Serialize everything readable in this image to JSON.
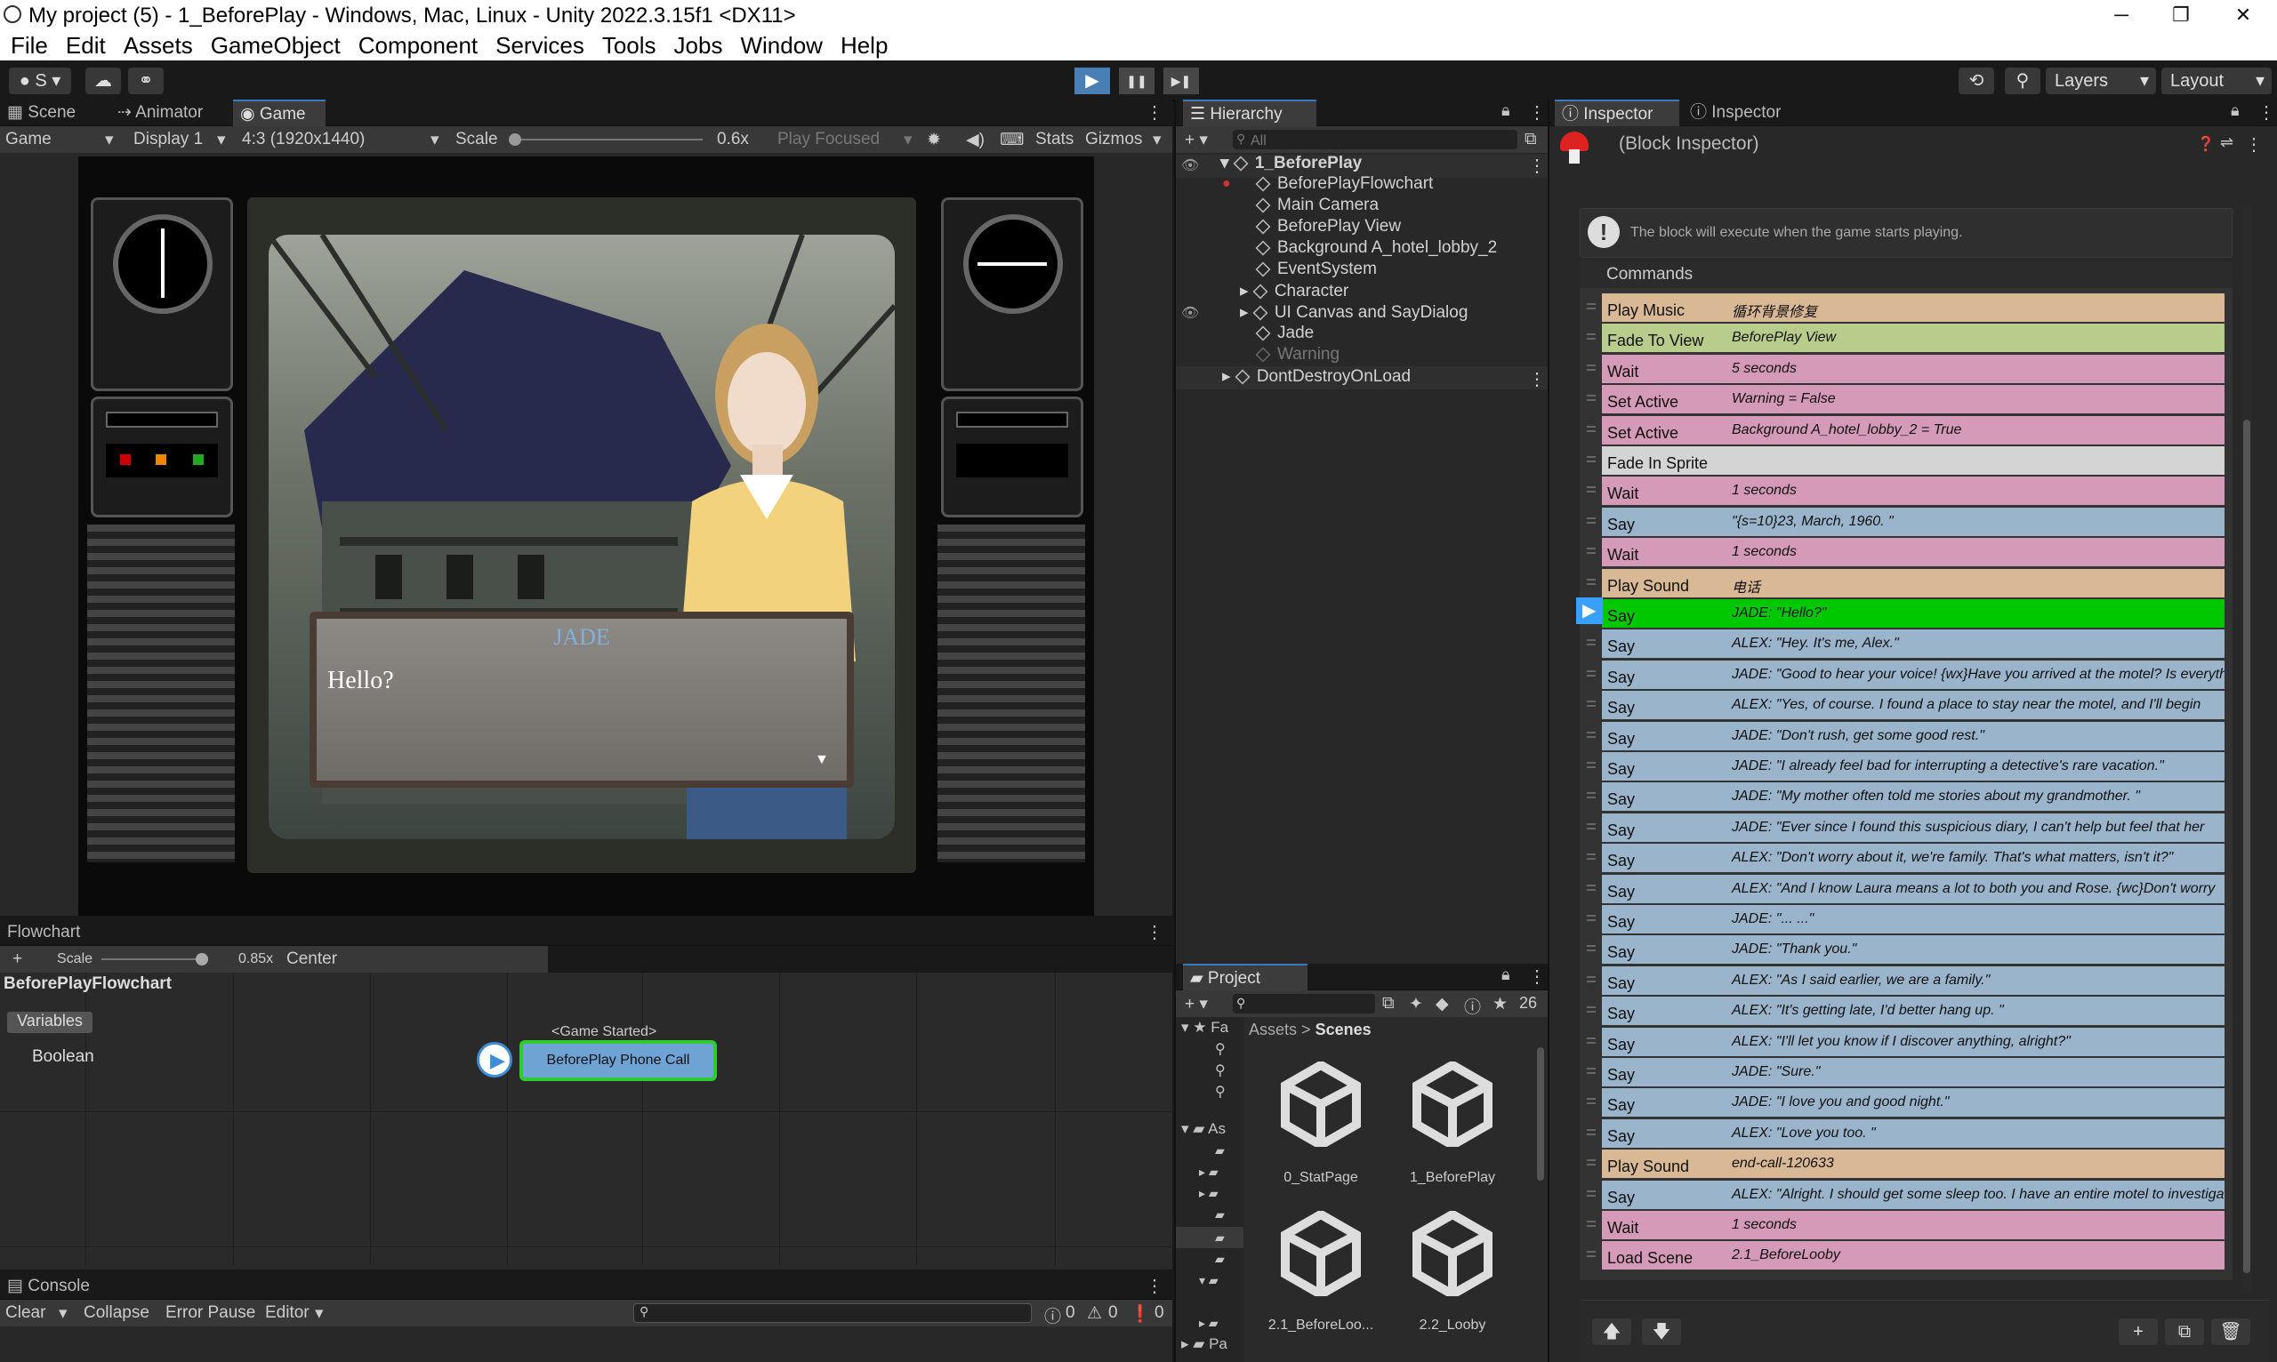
{
  "window": {
    "title": "My project (5) - 1_BeforePlay - Windows, Mac, Linux - Unity 2022.3.15f1 <DX11>",
    "minimize": "─",
    "maximize": "❐",
    "close": "✕"
  },
  "menu": [
    "File",
    "Edit",
    "Assets",
    "GameObject",
    "Component",
    "Services",
    "Tools",
    "Jobs",
    "Window",
    "Help"
  ],
  "toolbar": {
    "account": "S",
    "layers": "Layers",
    "layout": "Layout",
    "play": "▶",
    "pause": "❚❚",
    "step": "▶❚"
  },
  "scene_tabs": {
    "scene": "Scene",
    "animator": "Animator",
    "game": "Game"
  },
  "game_bar": {
    "mode": "Game",
    "display": "Display 1",
    "resolution": "4:3 (1920x1440)",
    "scale_label": "Scale",
    "scale_value": "0.6x",
    "play_focused": "Play Focused",
    "stats": "Stats",
    "gizmos": "Gizmos",
    "scale_fraction": 0.0
  },
  "game_view": {
    "speaker_name": "JADE",
    "dialog_text": "Hello?",
    "continue": "▼"
  },
  "flowchart": {
    "tab": "Flowchart",
    "scale_label": "Scale",
    "scale_value": "0.85x",
    "center": "Center",
    "name": "BeforePlayFlowchart",
    "variables": "Variables",
    "var_type": "Boolean",
    "block_event": "<Game Started>",
    "block_name": "BeforePlay Phone Call",
    "scale_fraction": 0.85
  },
  "console": {
    "tab": "Console",
    "clear": "Clear",
    "collapse": "Collapse",
    "error_pause": "Error Pause",
    "editor": "Editor",
    "info_count": "0",
    "warn_count": "0",
    "err_count": "0"
  },
  "hierarchy": {
    "tab": "Hierarchy",
    "search_placeholder": "All",
    "root": "1_BeforePlay",
    "items": [
      "BeforePlayFlowchart",
      "Main Camera",
      "BeforePlay View",
      "Background A_hotel_lobby_2",
      "EventSystem",
      "Character",
      "UI Canvas and SayDialog",
      "Jade",
      "Warning"
    ],
    "dont_destroy": "DontDestroyOnLoad"
  },
  "project": {
    "tab": "Project",
    "badge": "26",
    "breadcrumb_root": "Assets",
    "breadcrumb_sep": ">",
    "breadcrumb_leaf": "Scenes",
    "side_fa": "Fa",
    "side_as": "As",
    "side_pa": "Pa",
    "assets": [
      "0_StatPage",
      "1_BeforePlay",
      "2.1_BeforeLoo...",
      "2.2_Looby"
    ]
  },
  "inspector": {
    "tab1": "Inspector",
    "tab2": "Inspector",
    "header": "(Block Inspector)",
    "description": "The block will execute when the game starts playing.",
    "commands_label": "Commands",
    "commands": [
      {
        "name": "Play Music",
        "summary": "循环背景修复",
        "color": "#d9b896"
      },
      {
        "name": "Fade To View",
        "summary": "BeforePlay View",
        "color": "#b8cc8c"
      },
      {
        "name": "Wait",
        "summary": "5 seconds",
        "color": "#d49ab8"
      },
      {
        "name": "Set Active",
        "summary": "Warning = False",
        "color": "#d49ab8"
      },
      {
        "name": "Set Active",
        "summary": "Background A_hotel_lobby_2 = True",
        "color": "#d49ab8"
      },
      {
        "name": "Fade In Sprite",
        "summary": "",
        "color": "#d4d4d4"
      },
      {
        "name": "Wait",
        "summary": "1 seconds",
        "color": "#d49ab8"
      },
      {
        "name": "Say",
        "summary": "\"{s=10}23, March, 1960. \"",
        "color": "#9ab4cc"
      },
      {
        "name": "Wait",
        "summary": "1 seconds",
        "color": "#d49ab8"
      },
      {
        "name": "Play Sound",
        "summary": "电话",
        "color": "#d9b896"
      },
      {
        "name": "Say",
        "summary": "JADE: \"Hello?\"",
        "color": "#00c800"
      },
      {
        "name": "Say",
        "summary": "ALEX: \"Hey. It's me, Alex.\"",
        "color": "#9ab4cc"
      },
      {
        "name": "Say",
        "summary": "JADE: \"Good to hear your voice! {wx}Have you arrived at the motel? Is everything",
        "color": "#9ab4cc"
      },
      {
        "name": "Say",
        "summary": "ALEX: \"Yes, of course. I found a place to stay near the motel, and I'll begin",
        "color": "#9ab4cc"
      },
      {
        "name": "Say",
        "summary": "JADE: \"Don't rush, get some good rest.\"",
        "color": "#9ab4cc"
      },
      {
        "name": "Say",
        "summary": "JADE: \"I already feel bad for interrupting a detective's rare vacation.\"",
        "color": "#9ab4cc"
      },
      {
        "name": "Say",
        "summary": "JADE: \"My mother often told me stories about my grandmother. \"",
        "color": "#9ab4cc"
      },
      {
        "name": "Say",
        "summary": "JADE: \"Ever since I found this suspicious diary, I can't help but feel that her",
        "color": "#9ab4cc"
      },
      {
        "name": "Say",
        "summary": "ALEX: \"Don't worry about it, we're family. That's what matters, isn't it?\"",
        "color": "#9ab4cc"
      },
      {
        "name": "Say",
        "summary": "ALEX: \"And I know Laura means a lot to both you and Rose. {wc}Don't worry",
        "color": "#9ab4cc"
      },
      {
        "name": "Say",
        "summary": "JADE: \"... ...\"",
        "color": "#9ab4cc"
      },
      {
        "name": "Say",
        "summary": "JADE: \"Thank you.\"",
        "color": "#9ab4cc"
      },
      {
        "name": "Say",
        "summary": "ALEX: \"As I said earlier, we are a family.\"",
        "color": "#9ab4cc"
      },
      {
        "name": "Say",
        "summary": "ALEX: \"It's getting late, I'd better hang up. \"",
        "color": "#9ab4cc"
      },
      {
        "name": "Say",
        "summary": "ALEX: \"I'll let you know if I discover anything, alright?\"",
        "color": "#9ab4cc"
      },
      {
        "name": "Say",
        "summary": "JADE: \"Sure.\"",
        "color": "#9ab4cc"
      },
      {
        "name": "Say",
        "summary": "JADE: \"I love you and good night.\"",
        "color": "#9ab4cc"
      },
      {
        "name": "Say",
        "summary": "ALEX: \"Love you too. \"",
        "color": "#9ab4cc"
      },
      {
        "name": "Play Sound",
        "summary": "end-call-120633",
        "color": "#d9b896"
      },
      {
        "name": "Say",
        "summary": "ALEX: \"Alright. I should get some sleep too. I have an entire motel to investigate",
        "color": "#9ab4cc"
      },
      {
        "name": "Wait",
        "summary": "1 seconds",
        "color": "#d49ab8"
      },
      {
        "name": "Load Scene",
        "summary": "2.1_BeforeLooby",
        "color": "#d49ab8"
      }
    ]
  }
}
